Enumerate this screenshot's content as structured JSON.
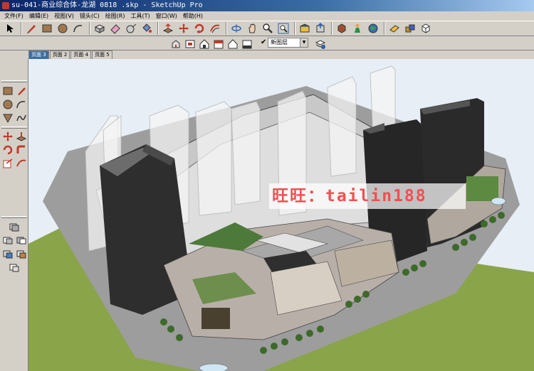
{
  "window": {
    "title": "su-041-商业综合体-龙湖 0818 .skp - SketchUp Pro"
  },
  "menu": [
    "文件(F)",
    "编辑(E)",
    "视图(V)",
    "镜头(C)",
    "绘图(R)",
    "工具(T)",
    "窗口(W)",
    "帮助(H)"
  ],
  "layers": {
    "current": "新图层"
  },
  "tabs": [
    "页面 3",
    "页面 2",
    "页面 4",
    "页面 5"
  ],
  "watermark": "旺旺：tailin188",
  "colors": {
    "grass": "#8aa44a",
    "road": "#9d9d9d",
    "sky": "#e7eef6",
    "tab_active": "#3a6ea5",
    "watermark": "#f05050"
  }
}
